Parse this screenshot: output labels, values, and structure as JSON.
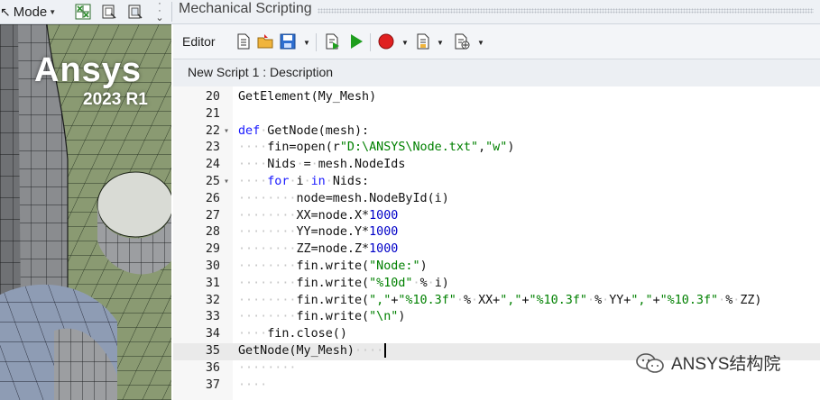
{
  "toolbar": {
    "mode_label": "Mode",
    "panel_title": "Mechanical Scripting"
  },
  "viewport": {
    "logo_text": "Ansys",
    "logo_version": "2023 R1"
  },
  "editor": {
    "label": "Editor",
    "tab_title": "New Script 1 : Description"
  },
  "code_lines": [
    {
      "num": "20",
      "fold": "",
      "html": "GetElement(My_Mesh)"
    },
    {
      "num": "21",
      "fold": "",
      "html": ""
    },
    {
      "num": "22",
      "fold": "▾",
      "html": "<span class=\"kw\">def</span><span class=\"ws\">·</span>GetNode(mesh):"
    },
    {
      "num": "23",
      "fold": "",
      "html": "<span class=\"ws\">····</span>fin=open(r<span class=\"str\">\"D:\\ANSYS\\Node.txt\"</span>,<span class=\"str\">\"w\"</span>)"
    },
    {
      "num": "24",
      "fold": "",
      "html": "<span class=\"ws\">····</span>Nids<span class=\"ws\">·</span>=<span class=\"ws\">·</span>mesh.NodeIds"
    },
    {
      "num": "25",
      "fold": "▾",
      "html": "<span class=\"ws\">····</span><span class=\"kw\">for</span><span class=\"ws\">·</span>i<span class=\"ws\">·</span><span class=\"kw\">in</span><span class=\"ws\">·</span>Nids:"
    },
    {
      "num": "26",
      "fold": "",
      "html": "<span class=\"ws\">········</span>node=mesh.NodeById(i)"
    },
    {
      "num": "27",
      "fold": "",
      "html": "<span class=\"ws\">········</span>XX=node.X*<span class=\"num\">1000</span>"
    },
    {
      "num": "28",
      "fold": "",
      "html": "<span class=\"ws\">········</span>YY=node.Y*<span class=\"num\">1000</span>"
    },
    {
      "num": "29",
      "fold": "",
      "html": "<span class=\"ws\">········</span>ZZ=node.Z*<span class=\"num\">1000</span>"
    },
    {
      "num": "30",
      "fold": "",
      "html": "<span class=\"ws\">········</span>fin.write(<span class=\"str\">\"Node:\"</span>)"
    },
    {
      "num": "31",
      "fold": "",
      "html": "<span class=\"ws\">········</span>fin.write(<span class=\"str\">\"%10d\"</span><span class=\"ws\">·</span>%<span class=\"ws\">·</span>i)"
    },
    {
      "num": "32",
      "fold": "",
      "html": "<span class=\"ws\">········</span>fin.write(<span class=\"str\">\",\"</span>+<span class=\"str\">\"%10.3f\"</span><span class=\"ws\">·</span>%<span class=\"ws\">·</span>XX+<span class=\"str\">\",\"</span>+<span class=\"str\">\"%10.3f\"</span><span class=\"ws\">·</span>%<span class=\"ws\">·</span>YY+<span class=\"str\">\",\"</span>+<span class=\"str\">\"%10.3f\"</span><span class=\"ws\">·</span>%<span class=\"ws\">·</span>ZZ)"
    },
    {
      "num": "33",
      "fold": "",
      "html": "<span class=\"ws\">········</span>fin.write(<span class=\"str\">\"\\n\"</span>)"
    },
    {
      "num": "34",
      "fold": "",
      "html": "<span class=\"ws\">····</span>fin.close()"
    },
    {
      "num": "35",
      "fold": "",
      "html": "GetNode(My_Mesh)<span class=\"ws\">····</span><span class=\"cursor\"></span>",
      "active": true
    },
    {
      "num": "36",
      "fold": "",
      "html": "<span class=\"ws\">········</span>"
    },
    {
      "num": "37",
      "fold": "",
      "html": "<span class=\"ws\">····</span>"
    }
  ],
  "watermark": {
    "text": "ANSYS结构院"
  },
  "colors": {
    "keyword": "#1a1aff",
    "string": "#008000",
    "number": "#0000c8",
    "record_red": "#e02020",
    "run_green": "#1e9e1e"
  }
}
